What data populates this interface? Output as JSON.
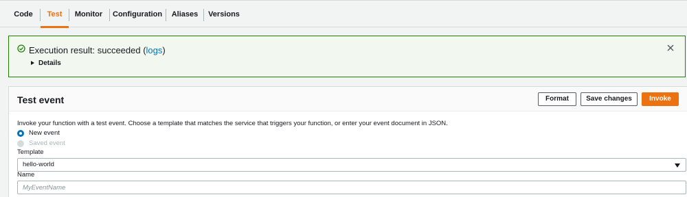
{
  "tabs": [
    {
      "label": "Code"
    },
    {
      "label": "Test",
      "active": true
    },
    {
      "label": "Monitor"
    },
    {
      "label": "Configuration"
    },
    {
      "label": "Aliases"
    },
    {
      "label": "Versions"
    }
  ],
  "alert": {
    "status": "success",
    "icon": "check-circle-icon",
    "title_prefix": "Execution result: succeeded (",
    "logs_link": "logs",
    "title_suffix": ")",
    "details_label": "Details"
  },
  "test_event": {
    "title": "Test event",
    "buttons": {
      "format": "Format",
      "save_changes": "Save changes",
      "invoke": "Invoke"
    },
    "description": "Invoke your function with a test event. Choose a template that matches the service that triggers your function, or enter your event document in JSON.",
    "options": [
      {
        "label": "New event",
        "selected": true,
        "disabled": false
      },
      {
        "label": "Saved event",
        "selected": false,
        "disabled": true
      }
    ],
    "template_label": "Template",
    "template_value": "hello-world",
    "name_label": "Name",
    "name_placeholder": "MyEventName",
    "name_value": ""
  },
  "colors": {
    "accent": "#ec7211",
    "link": "#0073bb",
    "success": "#1d8102",
    "success_bg": "#f2f8f0"
  }
}
